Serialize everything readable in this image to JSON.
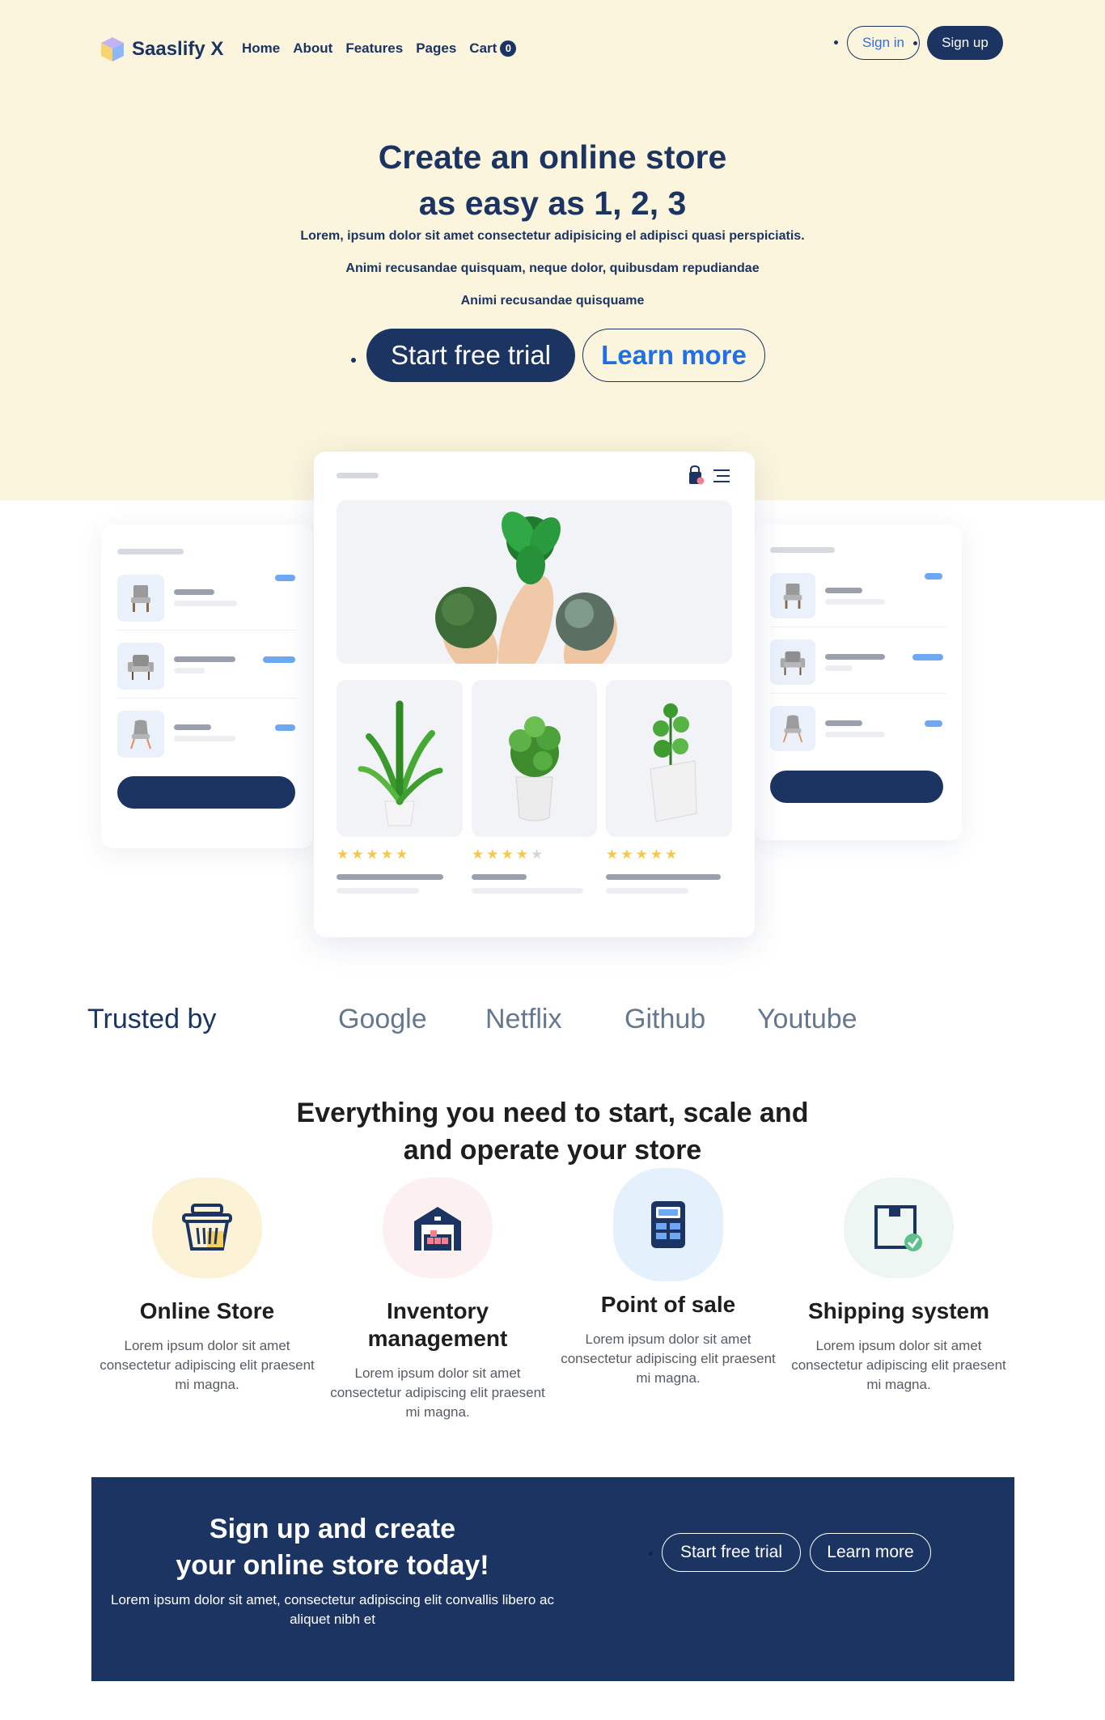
{
  "nav": {
    "brand": "Saaslify X",
    "links": [
      {
        "label": "Home"
      },
      {
        "label": "About"
      },
      {
        "label": "Features"
      },
      {
        "label": "Pages"
      },
      {
        "label": "Cart"
      }
    ],
    "cart_count": "0",
    "signin_label": "Sign in",
    "signup_label": "Sign up"
  },
  "hero": {
    "title_line1": "Create an online store",
    "title_line2": "as easy as 1, 2, 3",
    "subtitle_lines": [
      "Lorem, ipsum dolor sit amet consectetur adipisicing el adipisci quasi perspiciatis.",
      "Animi recusandae quisquam, neque dolor, quibusdam repudiandae",
      "Animi recusandae quisquame"
    ],
    "primary_cta": "Start free trial",
    "secondary_cta": "Learn more"
  },
  "mockup": {
    "product_ratings": [
      5,
      4,
      5
    ]
  },
  "trusted": {
    "label": "Trusted by",
    "brands": [
      "Google",
      "Netflix",
      "Github",
      "Youtube"
    ]
  },
  "features": {
    "title_line1": "Everything you need to start, scale and",
    "title_line2": "and operate your store",
    "items": [
      {
        "title": "Online Store",
        "desc": "Lorem ipsum dolor sit amet consectetur adipiscing elit praesent mi magna.",
        "icon": "basket-icon",
        "color": "#fcf3d6"
      },
      {
        "title": "Inventory management",
        "desc": "Lorem ipsum dolor sit amet consectetur adipiscing elit praesent mi magna.",
        "icon": "warehouse-icon",
        "color": "#fdf0f1"
      },
      {
        "title": "Point of sale",
        "desc": "Lorem ipsum dolor sit amet consectetur adipiscing elit praesent mi magna.",
        "icon": "pos-terminal-icon",
        "color": "#e5f0fd"
      },
      {
        "title": "Shipping system",
        "desc": "Lorem ipsum dolor sit amet consectetur adipiscing elit praesent mi magna.",
        "icon": "package-check-icon",
        "color": "#edf6f2"
      }
    ]
  },
  "cta": {
    "title_line1": "Sign up and create",
    "title_line2": "your online store today!",
    "desc": "Lorem ipsum dolor sit amet, consectetur adipiscing elit convallis libero ac aliquet nibh et",
    "primary": "Start free trial",
    "secondary": "Learn more"
  },
  "colors": {
    "navy": "#1b3461",
    "hero_bg": "#fcf5dd",
    "link_blue": "#1f6fe8",
    "accent_blue": "#6ea8f5",
    "star_yellow": "#f7c948"
  }
}
